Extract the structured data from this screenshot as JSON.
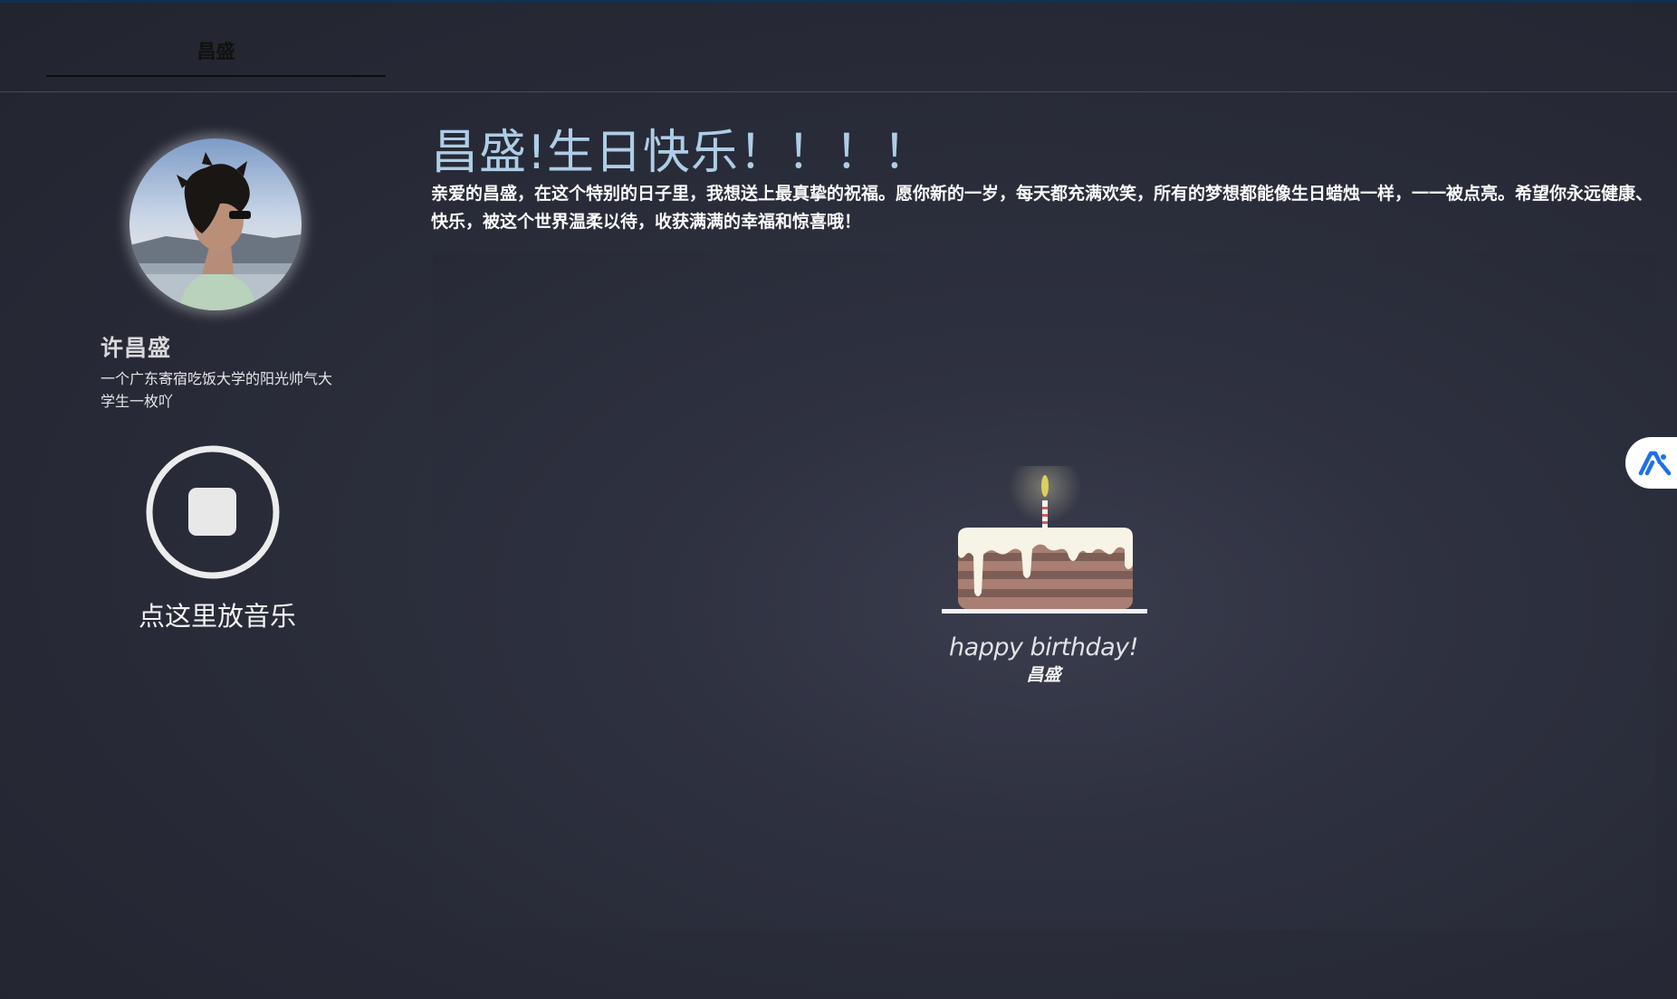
{
  "nav": {
    "tab_label": "昌盛"
  },
  "profile": {
    "name": "许昌盛",
    "bio": "一个广东寄宿吃饭大学的阳光帅气大学生一枚吖"
  },
  "music": {
    "label": "点这里放音乐",
    "state_icon": "stop-icon"
  },
  "main": {
    "title": "昌盛!生日快乐！！！！",
    "message": "亲爱的昌盛，在这个特别的日子里，我想送上最真挚的祝福。愿你新的一岁，每天都充满欢笑，所有的梦想都能像生日蜡烛一样，一一被点亮。希望你永远健康、快乐，被这个世界温柔以待，收获满满的幸福和惊喜哦！"
  },
  "cake": {
    "greeting": "happy birthday!",
    "name": "昌盛"
  },
  "floating_button": {
    "icon": "ai-assistant-icon"
  },
  "colors": {
    "title": "#aecde6",
    "background": "#2a2d3a",
    "cake_sponge": "#a87f72",
    "cake_layer": "#7d5e56",
    "icing": "#f7f3e6",
    "assistant_blue": "#1f6fe8"
  }
}
